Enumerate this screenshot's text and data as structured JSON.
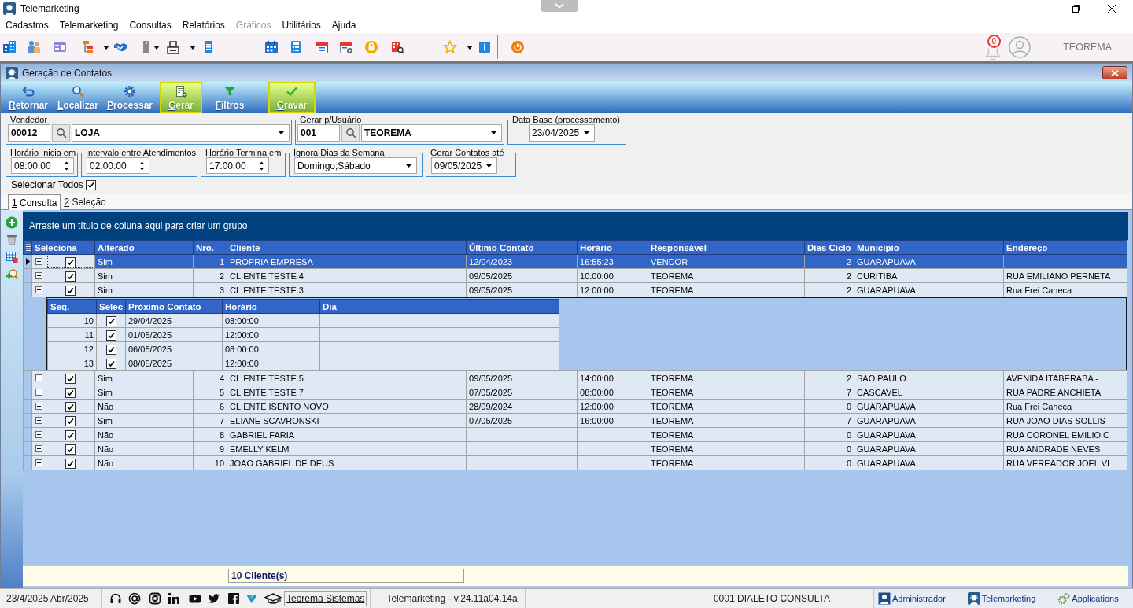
{
  "window": {
    "title": "Telemarketing"
  },
  "menu": [
    {
      "label": "Cadastros",
      "disabled": false
    },
    {
      "label": "Telemarketing",
      "disabled": false
    },
    {
      "label": "Consultas",
      "disabled": false
    },
    {
      "label": "Relatórios",
      "disabled": false
    },
    {
      "label": "Gráficos",
      "disabled": true
    },
    {
      "label": "Utilitários",
      "disabled": false
    },
    {
      "label": "Ajuda",
      "disabled": false
    }
  ],
  "toolbar": {
    "notifications": "0",
    "user": "TEOREMA"
  },
  "form_window": {
    "title": "Geração de Contatos",
    "actions": [
      {
        "label": "Retornar",
        "highlighted": false
      },
      {
        "label": "Localizar",
        "highlighted": false
      },
      {
        "label": "Processar",
        "highlighted": false
      },
      {
        "label": "Gerar",
        "highlighted": true
      },
      {
        "label": "Filtros",
        "highlighted": false
      },
      {
        "label": "Gravar",
        "highlighted": true
      }
    ],
    "fields_row_1": [
      {
        "kind": "lookup",
        "label": "Vendedor",
        "code": "00012",
        "value": "LOJA"
      },
      {
        "kind": "lookup",
        "label": "Gerar p/Usuário",
        "code": "001",
        "value": "TEOREMA"
      },
      {
        "kind": "date",
        "label": "Data Base (processamento)",
        "value": "23/04/2025"
      }
    ],
    "fields_row_2": [
      {
        "kind": "spin",
        "label": "Horário Inicia em",
        "value": "08:00:00"
      },
      {
        "kind": "spin",
        "label": "Intervalo entre Atendimentos",
        "value": "02:00:00"
      },
      {
        "kind": "spin",
        "label": "Horário Termina em",
        "value": "17:00:00"
      },
      {
        "kind": "combo",
        "label": "Ignora Dias da Semana",
        "value": "Domingo;Sábado"
      },
      {
        "kind": "date",
        "label": "Gerar Contatos até",
        "value": "09/05/2025"
      }
    ],
    "select_all": {
      "label": "Selecionar Todos",
      "checked": true
    },
    "tabs": [
      {
        "label": "1 Consulta",
        "selected": true
      },
      {
        "label": "2 Seleção",
        "selected": false
      }
    ],
    "grid": {
      "group_panel": "Arraste um título de coluna aqui para criar um grupo",
      "columns": [
        "Seleciona",
        "Alterado",
        "Nro.",
        "Cliente",
        "Último Contato",
        "Horário",
        "Responsável",
        "Dias Ciclo",
        "Município",
        "Endereço"
      ],
      "rows": [
        {
          "selected": true,
          "expanded": false,
          "checked": true,
          "alterado": "Sim",
          "nro": "1",
          "cliente": "PROPRIA EMPRESA",
          "ultimo_contato": "12/04/2023",
          "horario": "16:55:23",
          "responsavel": "VENDOR",
          "dias_ciclo": "2",
          "municipio": "GUARAPUAVA"
        },
        {
          "selected": false,
          "expanded": false,
          "checked": true,
          "alterado": "Sim",
          "nro": "2",
          "cliente": "CLIENTE TESTE 4",
          "ultimo_contato": "09/05/2025",
          "horario": "10:00:00",
          "responsavel": "TEOREMA",
          "dias_ciclo": "2",
          "municipio": "CURITIBA",
          "endereco": "RUA EMILIANO PERNETA"
        },
        {
          "selected": false,
          "expanded": true,
          "checked": true,
          "alterado": "Sim",
          "nro": "3",
          "cliente": "CLIENTE TESTE 3",
          "ultimo_contato": "09/05/2025",
          "horario": "12:00:00",
          "responsavel": "TEOREMA",
          "dias_ciclo": "2",
          "municipio": "GUARAPUAVA",
          "endereco": "Rua Frei Caneca",
          "details": {
            "columns": [
              "Seq.",
              "Selec",
              "Próximo Contato",
              "Horário",
              "Dia"
            ],
            "rows": [
              {
                "seq": "10",
                "checked": true,
                "proximo_contato": "29/04/2025",
                "horario": "08:00:00"
              },
              {
                "seq": "11",
                "checked": true,
                "proximo_contato": "01/05/2025",
                "horario": "12:00:00"
              },
              {
                "seq": "12",
                "checked": true,
                "proximo_contato": "06/05/2025",
                "horario": "08:00:00"
              },
              {
                "seq": "13",
                "checked": true,
                "proximo_contato": "08/05/2025",
                "horario": "12:00:00"
              }
            ]
          }
        },
        {
          "selected": false,
          "expanded": false,
          "checked": true,
          "alterado": "Sim",
          "nro": "4",
          "cliente": "CLIENTE TESTE 5",
          "ultimo_contato": "09/05/2025",
          "horario": "14:00:00",
          "responsavel": "TEOREMA",
          "dias_ciclo": "2",
          "municipio": "SAO PAULO",
          "endereco": "AVENIDA ITABERABA -"
        },
        {
          "selected": false,
          "expanded": false,
          "checked": true,
          "alterado": "Sim",
          "nro": "5",
          "cliente": "CLIENTE TESTE 7",
          "ultimo_contato": "07/05/2025",
          "horario": "08:00:00",
          "responsavel": "TEOREMA",
          "dias_ciclo": "7",
          "municipio": "CASCAVEL",
          "endereco": "RUA PADRE ANCHIETA"
        },
        {
          "selected": false,
          "expanded": false,
          "checked": true,
          "alterado": "Não",
          "nro": "6",
          "cliente": "CLIENTE ISENTO NOVO",
          "ultimo_contato": "28/09/2024",
          "horario": "12:00:00",
          "responsavel": "TEOREMA",
          "dias_ciclo": "0",
          "municipio": "GUARAPUAVA",
          "endereco": "Rua Frei Caneca"
        },
        {
          "selected": false,
          "expanded": false,
          "checked": true,
          "alterado": "Sim",
          "nro": "7",
          "cliente": "ELIANE SCAVRONSKI",
          "ultimo_contato": "07/05/2025",
          "horario": "16:00:00",
          "responsavel": "TEOREMA",
          "dias_ciclo": "7",
          "municipio": "GUARAPUAVA",
          "endereco": "RUA JOAO DIAS SOLLIS"
        },
        {
          "selected": false,
          "expanded": false,
          "checked": true,
          "alterado": "Não",
          "nro": "8",
          "cliente": "GABRIEL FARIA",
          "responsavel": "TEOREMA",
          "dias_ciclo": "0",
          "municipio": "GUARAPUAVA",
          "endereco": "RUA CORONEL EMILIO C"
        },
        {
          "selected": false,
          "expanded": false,
          "checked": true,
          "alterado": "Não",
          "nro": "9",
          "cliente": "EMELLY KELM",
          "responsavel": "TEOREMA",
          "dias_ciclo": "0",
          "municipio": "GUARAPUAVA",
          "endereco": "RUA ANDRADE NEVES"
        },
        {
          "selected": false,
          "expanded": false,
          "checked": true,
          "alterado": "Não",
          "nro": "10",
          "cliente": "JOAO GABRIEL DE DEUS",
          "responsavel": "TEOREMA",
          "dias_ciclo": "0",
          "municipio": "GUARAPUAVA",
          "endereco": "RUA VEREADOR JOEL VI"
        }
      ],
      "footer": "10 Cliente(s)"
    }
  },
  "status_bar": {
    "date": "23/4/2025 Abr/2025",
    "link": "Teorema Sistemas",
    "version": "Telemarketing - v.24.11a04.14a",
    "company": "0001 DIALETO CONSULTA",
    "tasks": [
      "Administrador",
      "Telemarketing",
      "Applications"
    ]
  }
}
